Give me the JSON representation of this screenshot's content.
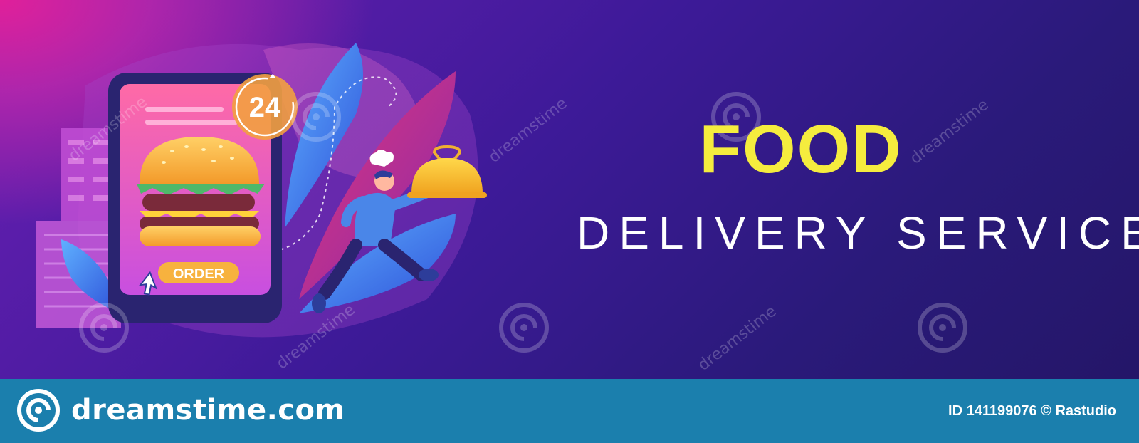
{
  "banner": {
    "headline": "FOOD",
    "subheadline": "DELIVERY SERVICE",
    "illustration": {
      "timer_label": "24",
      "order_button_label": "ORDER"
    },
    "watermark_text": "dreamstime"
  },
  "footer": {
    "logo_text": "dreamstime.com",
    "image_id": "ID 141199076 © Rastudio"
  },
  "colors": {
    "headline": "#f5ec3e",
    "subheadline": "#ffffff",
    "footer_background": "#1b7fad",
    "background_dark": "#2a1a7a",
    "background_magenta": "#e0209a"
  },
  "icons": [
    "burger-icon",
    "chef-icon",
    "cloche-icon",
    "cursor-arrow-icon",
    "clock-arrow-icon",
    "dreamstime-swirl-icon"
  ]
}
